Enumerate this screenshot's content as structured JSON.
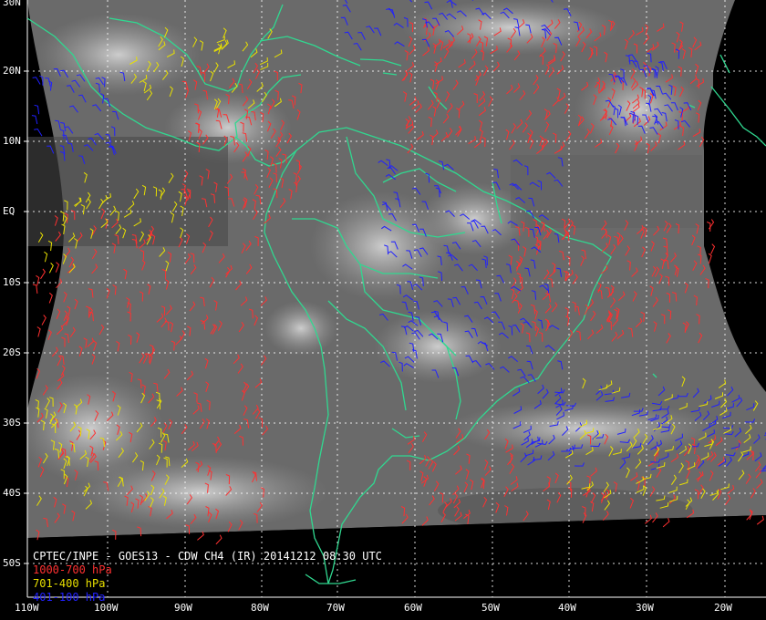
{
  "caption": {
    "title": "CPTEC/INPE - GOES13 - CDW CH4 (IR) 20141212 08:30 UTC",
    "low": "1000-700 hPa",
    "mid": "701-400 hPa",
    "high": "401-100 hPa"
  },
  "lat_labels": [
    "30N",
    "20N",
    "10N",
    "EQ",
    "10S",
    "20S",
    "30S",
    "40S",
    "50S"
  ],
  "lon_labels": [
    "110W",
    "100W",
    "90W",
    "80W",
    "70W",
    "60W",
    "50W",
    "40W",
    "30W",
    "20W"
  ],
  "colors": {
    "low": "#ff3030",
    "mid": "#e8e000",
    "high": "#2020ff",
    "coast": "#30d890",
    "grid": "#ffffff"
  }
}
